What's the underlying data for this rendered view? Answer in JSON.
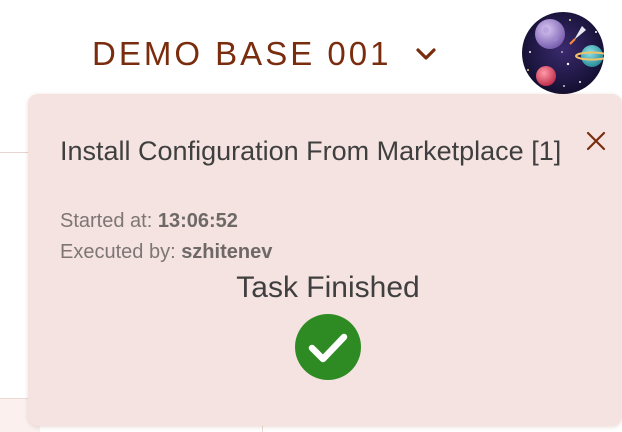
{
  "header": {
    "base_title": "DEMO BASE 001",
    "chevron_icon": "chevron-down-icon",
    "avatar_icon": "space-avatar-icon",
    "accent_color": "#7a2d0e"
  },
  "toast": {
    "background_color": "#f4e3e0",
    "close_icon": "close-icon",
    "title": "Install Configuration From Marketplace [1]",
    "started_label": "Started at:",
    "started_value": "13:06:52",
    "executed_label": "Executed by:",
    "executed_value": "szhitenev",
    "status_text": "Task Finished",
    "status_icon": "check-circle-icon",
    "status_color": "#2e8b23"
  }
}
